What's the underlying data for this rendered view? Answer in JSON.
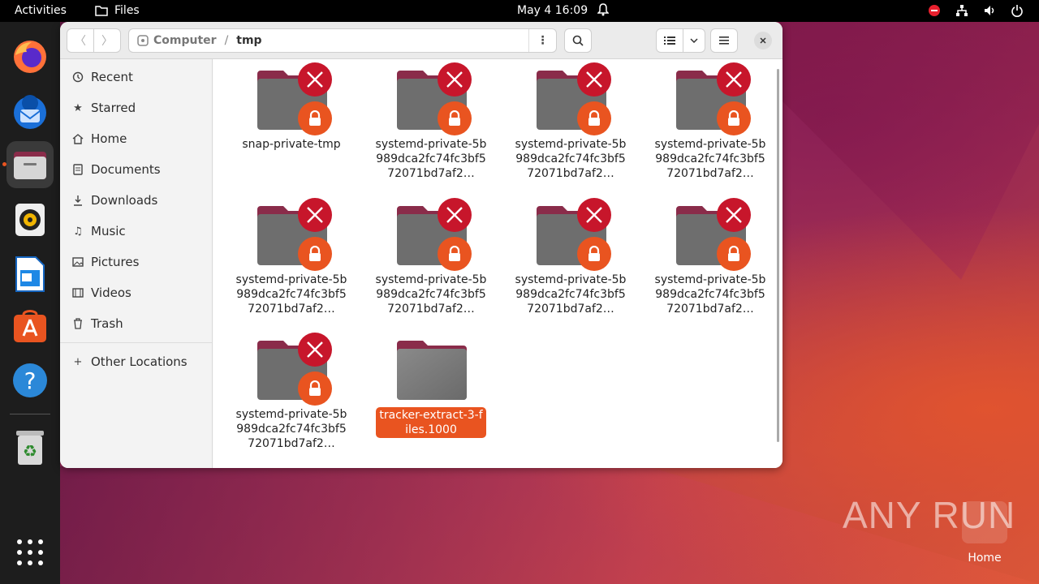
{
  "topbar": {
    "activities": "Activities",
    "app_name": "Files",
    "clock": "May 4  16:09"
  },
  "window": {
    "path": {
      "root": "Computer",
      "current": "tmp"
    }
  },
  "sidebar": {
    "items": [
      {
        "label": "Recent",
        "icon": "clock-icon"
      },
      {
        "label": "Starred",
        "icon": "star-icon"
      },
      {
        "label": "Home",
        "icon": "home-icon"
      },
      {
        "label": "Documents",
        "icon": "document-icon"
      },
      {
        "label": "Downloads",
        "icon": "download-icon"
      },
      {
        "label": "Music",
        "icon": "music-icon"
      },
      {
        "label": "Pictures",
        "icon": "picture-icon"
      },
      {
        "label": "Videos",
        "icon": "video-icon"
      },
      {
        "label": "Trash",
        "icon": "trash-icon"
      },
      {
        "label": "Other Locations",
        "icon": "plus-icon"
      }
    ]
  },
  "files": [
    {
      "label": "snap-private-tmp",
      "locked": true
    },
    {
      "label": "systemd-private-5b989dca2fc74fc3bf572071bd7af2…",
      "locked": true
    },
    {
      "label": "systemd-private-5b989dca2fc74fc3bf572071bd7af2…",
      "locked": true
    },
    {
      "label": "systemd-private-5b989dca2fc74fc3bf572071bd7af2…",
      "locked": true
    },
    {
      "label": "systemd-private-5b989dca2fc74fc3bf572071bd7af2…",
      "locked": true
    },
    {
      "label": "systemd-private-5b989dca2fc74fc3bf572071bd7af2…",
      "locked": true
    },
    {
      "label": "systemd-private-5b989dca2fc74fc3bf572071bd7af2…",
      "locked": true
    },
    {
      "label": "systemd-private-5b989dca2fc74fc3bf572071bd7af2…",
      "locked": true
    },
    {
      "label": "systemd-private-5b989dca2fc74fc3bf572071bd7af2…",
      "locked": true
    },
    {
      "label": "tracker-extract-3-files.1000",
      "locked": false,
      "selected": true
    }
  ],
  "desktop": {
    "home_label": "Home",
    "watermark": "ANY RUN"
  },
  "colors": {
    "accent": "#e95420",
    "error": "#c7162b",
    "folder": "#6e6e6e",
    "folder_tab": "#8a2c4a"
  }
}
